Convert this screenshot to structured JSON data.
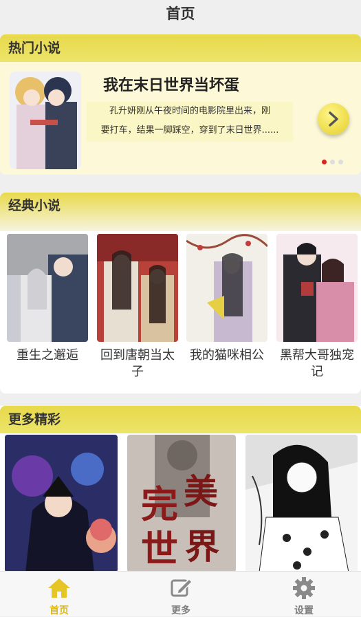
{
  "header": {
    "title": "首页"
  },
  "hot": {
    "section_title": "热门小说",
    "book_title": "我在末日世界当坏蛋",
    "description": "孔升妍刚从午夜时间的电影院里出来，刚要打车，结果一脚踩空，穿到了末日世界......",
    "description_line1": "孔升妍刚从午夜时间的电影院里出来，刚",
    "description_line2": "要打车，结果一脚踩空，穿到了末日世界......",
    "next_icon": "chevron-right-icon",
    "carousel_pages": 3,
    "carousel_active": 1
  },
  "classic": {
    "section_title": "经典小说",
    "books": [
      {
        "title": "重生之邂逅"
      },
      {
        "title": "回到唐朝当太子"
      },
      {
        "title": "我的猫咪相公"
      },
      {
        "title": "黑帮大哥独宠记"
      }
    ]
  },
  "more": {
    "section_title": "更多精彩"
  },
  "tabbar": {
    "items": [
      {
        "label": "首页",
        "icon": "home-icon",
        "active": true
      },
      {
        "label": "更多",
        "icon": "edit-icon",
        "active": false
      },
      {
        "label": "设置",
        "icon": "gear-icon",
        "active": false
      }
    ]
  },
  "colors": {
    "accent": "#e8d94b",
    "active_tab": "#d9b91e",
    "inactive_tab": "#8a8a8a"
  }
}
